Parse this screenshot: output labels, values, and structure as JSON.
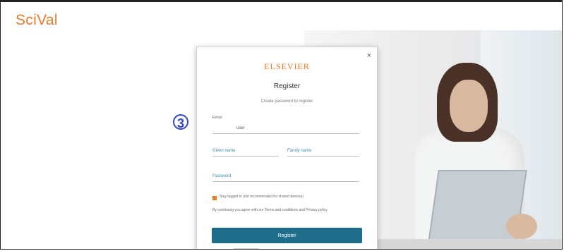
{
  "app": {
    "title": "SciVal"
  },
  "annotation": {
    "step": "3"
  },
  "modal": {
    "close_label": "×",
    "brand": "ELSEVIER",
    "title": "Register",
    "subtitle": "Create password to register",
    "fields": {
      "email_label": "Email",
      "email_value": "user",
      "given_name_label": "Given name",
      "family_name_label": "Family name",
      "password_label": "Password"
    },
    "checkbox_text": "Stay logged in (not recommended for shared devices)",
    "terms_text": "By continuing you agree with our Terms and conditions and Privacy policy",
    "register_button": "Register"
  },
  "colors": {
    "logo": "#e8792b",
    "button": "#1f6d8b",
    "annotation": "#3145c9"
  }
}
